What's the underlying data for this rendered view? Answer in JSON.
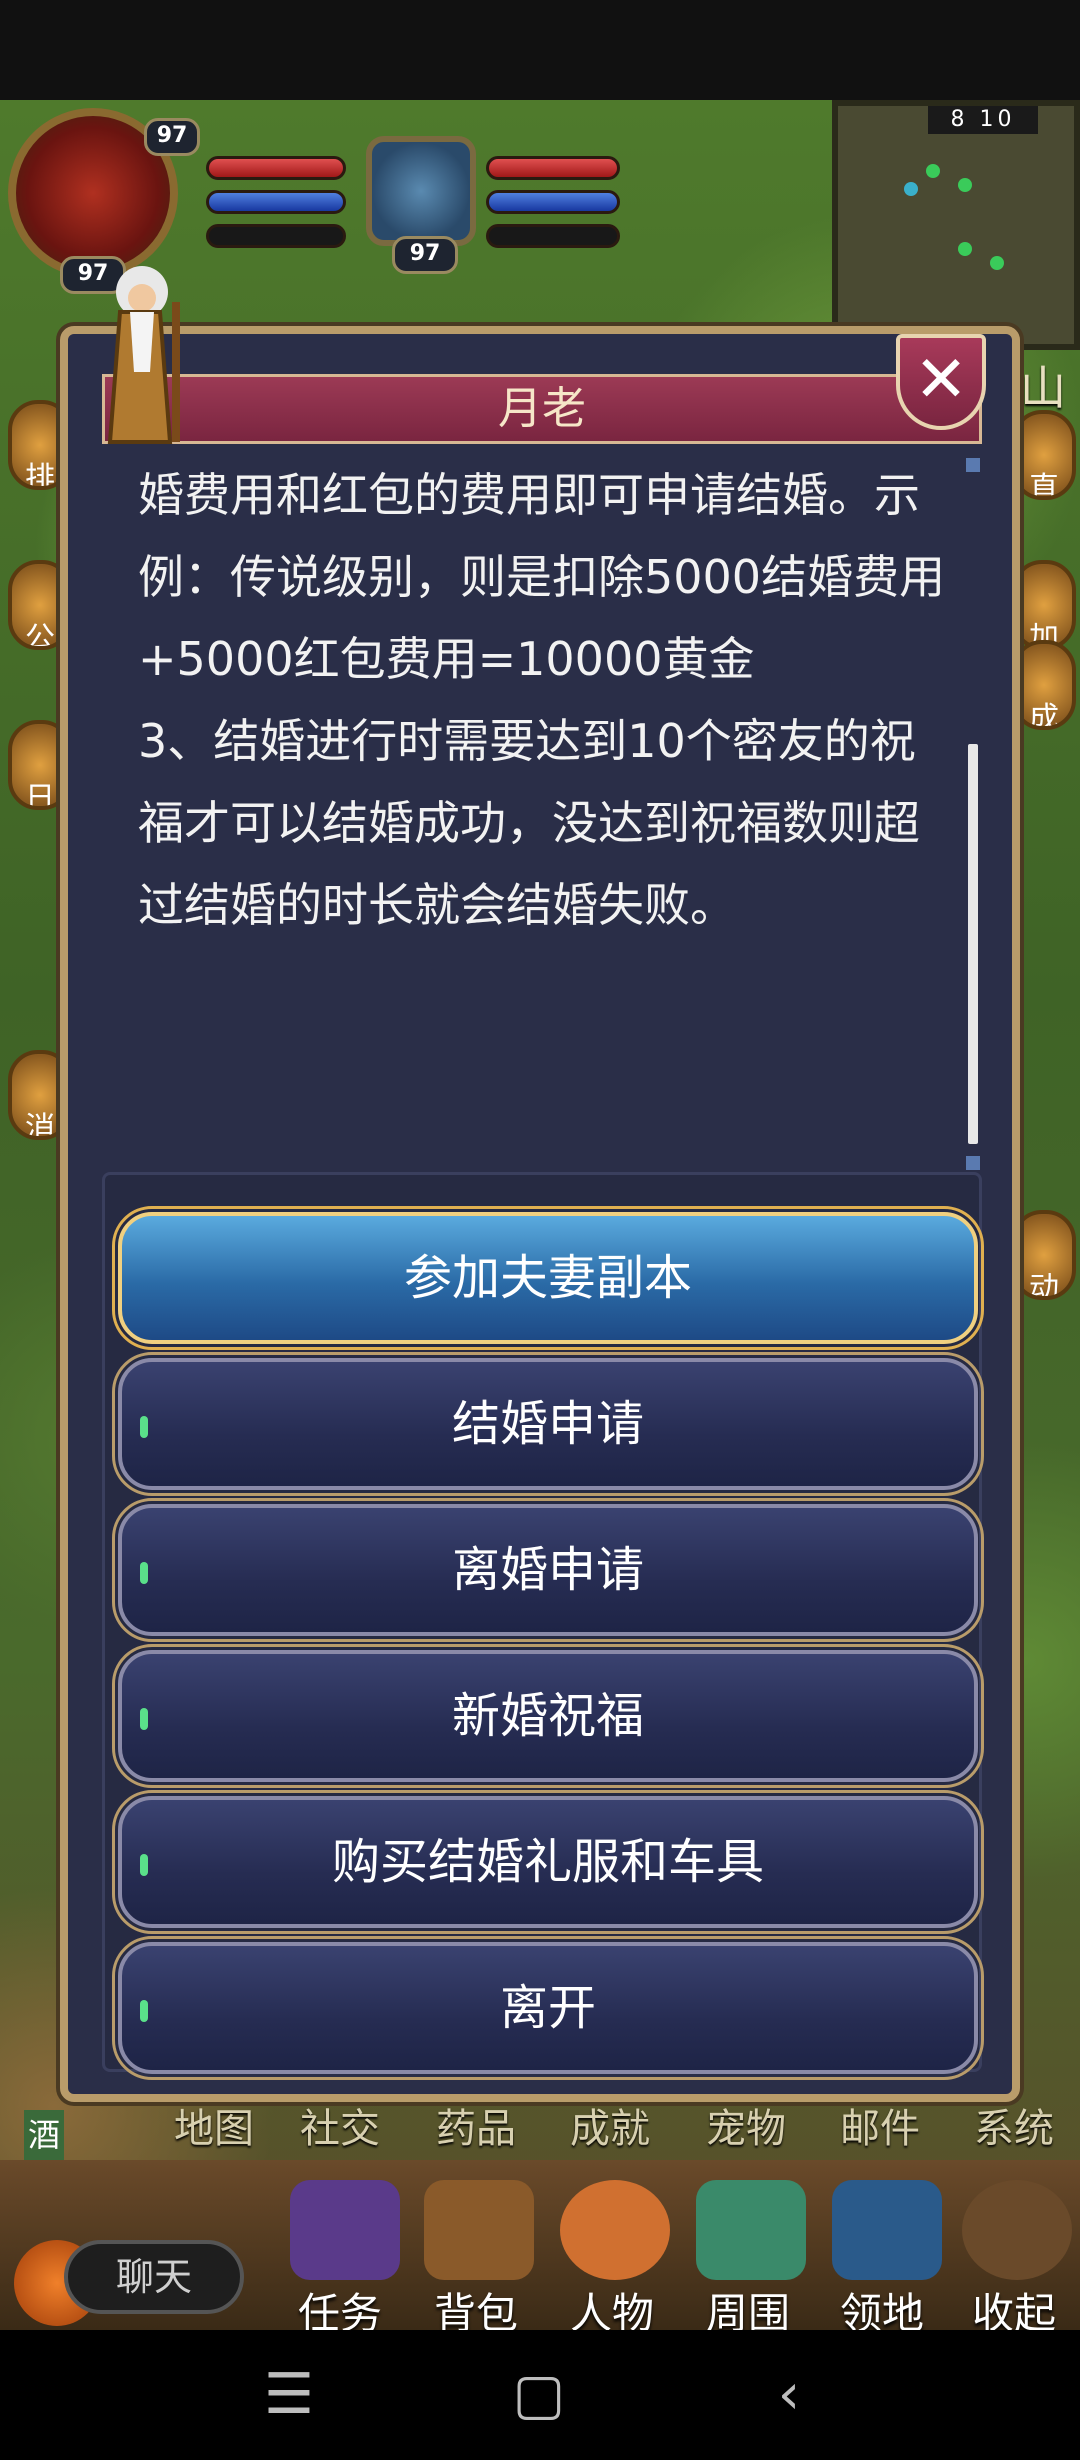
{
  "hud": {
    "player_level": "97",
    "player_level_bottom": "97",
    "pet_level": "97",
    "minimap_coords": "8 10",
    "side_label_right": "山",
    "side_labels_left": [
      "排",
      "公",
      "日",
      "消"
    ],
    "side_labels_right": [
      "直",
      "加",
      "成",
      "动"
    ]
  },
  "dialog": {
    "title": "月老",
    "close_label": "✕",
    "paragraphs": [
      "婚费用和红包的费用即可申请结婚。示例：传说级别，则是扣除5000结婚费用+5000红包费用=10000黄金",
      "3、结婚进行时需要达到10个密友的祝福才可以结婚成功，没达到祝福数则超过结婚的时长就会结婚失败。"
    ],
    "options": [
      "参加夫妻副本",
      "结婚申请",
      "离婚申请",
      "新婚祝福",
      "购买结婚礼服和车具",
      "离开"
    ]
  },
  "tabs": [
    "地图",
    "社交",
    "药品",
    "成就",
    "宠物",
    "邮件",
    "系统"
  ],
  "menu": [
    "任务",
    "背包",
    "人物",
    "周围",
    "领地",
    "收起"
  ],
  "chat_label": "聊天",
  "tavern_sign": "酒",
  "colors": {
    "dialog_bg": "#2a2e48",
    "title_bar": "#8a2d48",
    "primary_button": "#2a6aa6",
    "option_button": "#2a3058",
    "gold_border": "#b99c6a"
  }
}
